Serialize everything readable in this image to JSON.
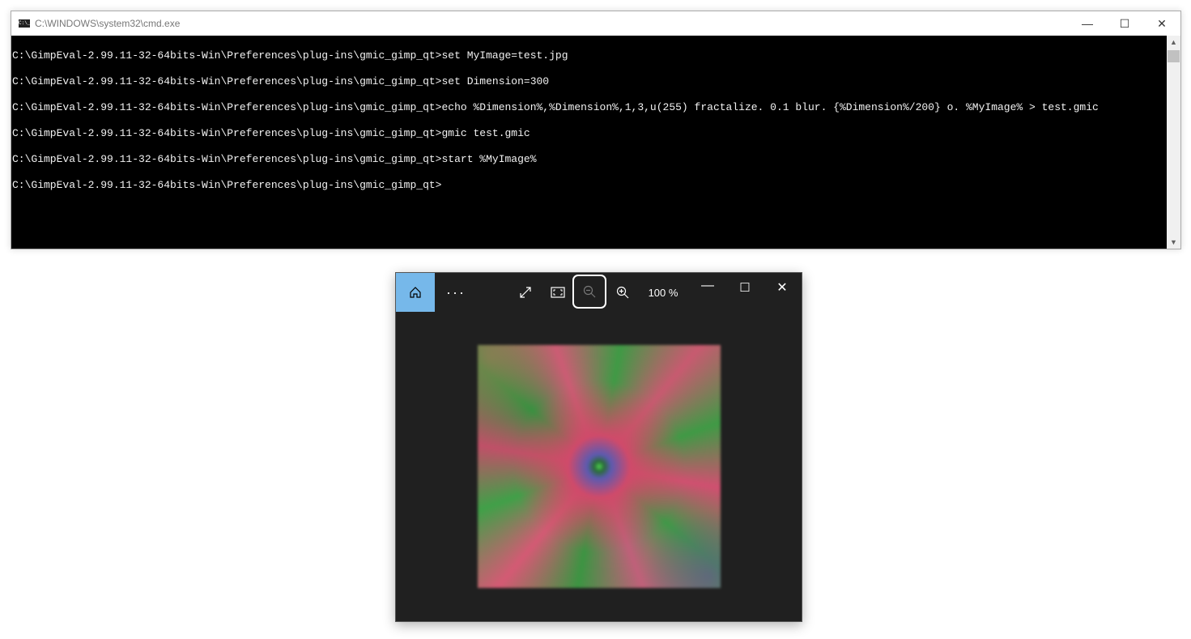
{
  "cmd": {
    "title": "C:\\WINDOWS\\system32\\cmd.exe",
    "icon_text": "C:\\_",
    "lines": [
      "C:\\GimpEval-2.99.11-32-64bits-Win\\Preferences\\plug-ins\\gmic_gimp_qt>set MyImage=test.jpg",
      "C:\\GimpEval-2.99.11-32-64bits-Win\\Preferences\\plug-ins\\gmic_gimp_qt>set Dimension=300",
      "C:\\GimpEval-2.99.11-32-64bits-Win\\Preferences\\plug-ins\\gmic_gimp_qt>echo %Dimension%,%Dimension%,1,3,u(255) fractalize. 0.1 blur. {%Dimension%/200} o. %MyImage% > test.gmic",
      "C:\\GimpEval-2.99.11-32-64bits-Win\\Preferences\\plug-ins\\gmic_gimp_qt>gmic test.gmic",
      "C:\\GimpEval-2.99.11-32-64bits-Win\\Preferences\\plug-ins\\gmic_gimp_qt>start %MyImage%",
      "C:\\GimpEval-2.99.11-32-64bits-Win\\Preferences\\plug-ins\\gmic_gimp_qt>"
    ]
  },
  "photos": {
    "zoom_level": "100 %"
  }
}
